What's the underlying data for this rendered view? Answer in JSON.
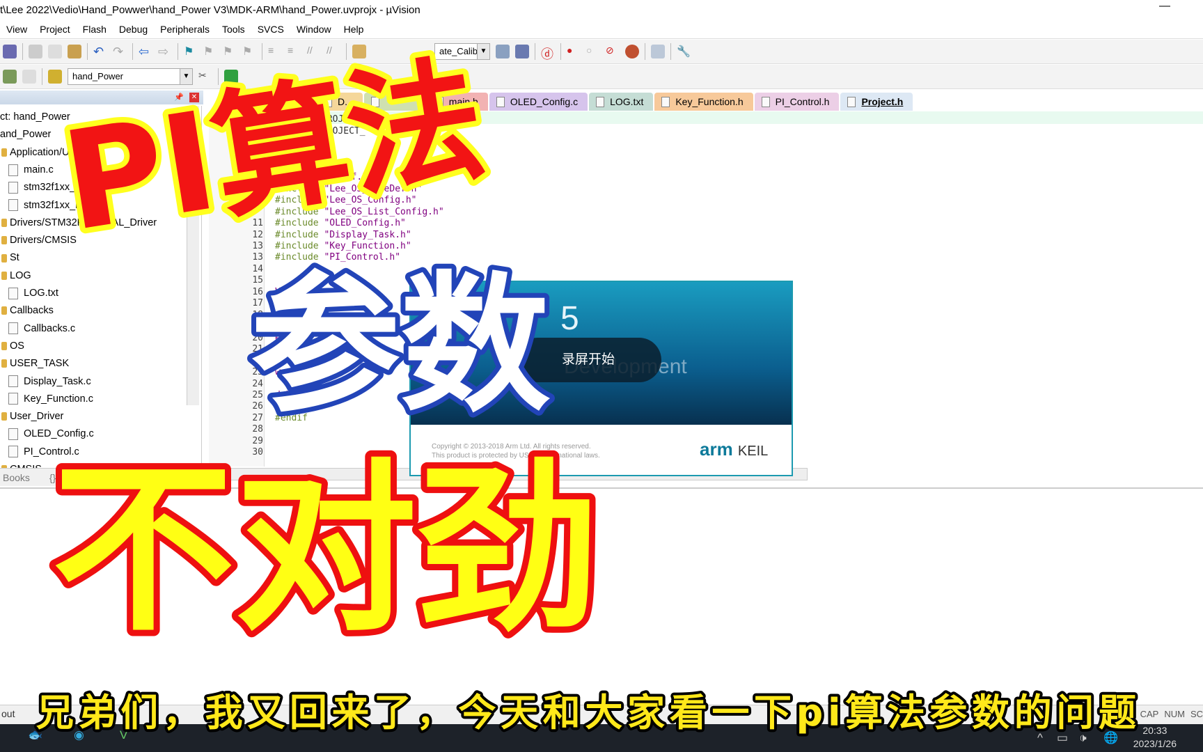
{
  "window": {
    "title": "t\\Lee 2022\\Vedio\\Hand_Powwer\\hand_Power V3\\MDK-ARM\\hand_Power.uvprojx - µVision",
    "minimize": "—"
  },
  "menu": [
    "View",
    "Project",
    "Flash",
    "Debug",
    "Peripherals",
    "Tools",
    "SVCS",
    "Window",
    "Help"
  ],
  "toolbar": {
    "config_combo": "ate_Calib",
    "target_combo": "hand_Power"
  },
  "project_panel": {
    "items": [
      {
        "label": "ct: hand_Power",
        "type": "root"
      },
      {
        "label": "and_Power",
        "type": "target"
      },
      {
        "label": "Application/U",
        "type": "group"
      },
      {
        "label": "main.c",
        "type": "file"
      },
      {
        "label": "stm32f1xx_",
        "type": "file"
      },
      {
        "label": "stm32f1xx_h",
        "type": "file"
      },
      {
        "label": "Drivers/STM32F1xx_HAL_Driver",
        "type": "group"
      },
      {
        "label": "Drivers/CMSIS",
        "type": "group"
      },
      {
        "label": "St",
        "type": "group"
      },
      {
        "label": "LOG",
        "type": "group"
      },
      {
        "label": "LOG.txt",
        "type": "file"
      },
      {
        "label": "Callbacks",
        "type": "group"
      },
      {
        "label": "Callbacks.c",
        "type": "file"
      },
      {
        "label": "OS",
        "type": "group"
      },
      {
        "label": "USER_TASK",
        "type": "group"
      },
      {
        "label": "Display_Task.c",
        "type": "file"
      },
      {
        "label": "Key_Function.c",
        "type": "file"
      },
      {
        "label": "User_Driver",
        "type": "group"
      },
      {
        "label": "OLED_Config.c",
        "type": "file"
      },
      {
        "label": "PI_Control.c",
        "type": "file"
      },
      {
        "label": "CMSIS",
        "type": "group"
      }
    ],
    "tabs": [
      "Books",
      "{} Functions"
    ]
  },
  "editor_tabs": [
    {
      "label": "D...",
      "color": "#f5d79a"
    },
    {
      "label": "",
      "color": "#cfe0b0"
    },
    {
      "label": "main.h",
      "color": "#f2b2b2"
    },
    {
      "label": "OLED_Config.c",
      "color": "#d6c4ec"
    },
    {
      "label": "LOG.txt",
      "color": "#c5ddd5"
    },
    {
      "label": "Key_Function.h",
      "color": "#f7c99a"
    },
    {
      "label": "PI_Control.h",
      "color": "#eccfe6"
    },
    {
      "label": "Project.h",
      "color": "#dde8f4",
      "active": true
    }
  ],
  "code": [
    {
      "n": "",
      "text": "PROJECT_"
    },
    {
      "n": "",
      "text": "PROJECT_"
    },
    {
      "n": "",
      "pp": "",
      "text": "\"Lee_OS_TypeDef.h\""
    },
    {
      "n": "",
      "pp": "#include ",
      "text": "\"Lee_OS_TypeDef.h\""
    },
    {
      "n": "",
      "pp": "#include ",
      "text": "\"Lee_OS_Config.h\""
    },
    {
      "n": "",
      "pp": "#include ",
      "text": "\"Lee_OS_List_Config.h\""
    },
    {
      "n": "11",
      "pp": "#include ",
      "text": "\"OLED_Config.h\""
    },
    {
      "n": "12",
      "pp": "#include ",
      "text": "\"Display_Task.h\""
    },
    {
      "n": "13",
      "pp": "#include ",
      "text": "\"Key_Function.h\""
    },
    {
      "n": "13",
      "pp": "#include ",
      "text": "\"PI_Control.h\""
    },
    {
      "n": "14",
      "text": ""
    },
    {
      "n": "15",
      "text": ""
    },
    {
      "n": "16",
      "text": "Va"
    },
    {
      "n": "17",
      "text": ""
    },
    {
      "n": "18",
      "text": ""
    },
    {
      "n": "19",
      "text": ""
    },
    {
      "n": "20",
      "text": "eD"
    },
    {
      "n": "21",
      "text": ""
    },
    {
      "n": "22",
      "text": ""
    },
    {
      "n": "23",
      "text": "we"
    },
    {
      "n": "24",
      "text": ""
    },
    {
      "n": "25",
      "text": "debug["
    },
    {
      "n": "26",
      "text": ""
    },
    {
      "n": "27",
      "pp": "#endif",
      "text": ""
    },
    {
      "n": "28",
      "text": ""
    },
    {
      "n": "29",
      "text": ""
    },
    {
      "n": "30",
      "text": ""
    }
  ],
  "splash": {
    "version": "5",
    "tagline": "Development",
    "recording": "录屏开始",
    "copyright": "Copyright © 2013-2018 Arm Ltd. All rights reserved.",
    "notice": "This product is protected by US and international laws.",
    "logo": "arm KEIL"
  },
  "status": {
    "output_tab": "out",
    "indicators": [
      "CAP",
      "NUM",
      "SC"
    ]
  },
  "taskbar": {
    "time": "20:33",
    "date": "2023/1/26"
  },
  "overlay": {
    "line1": "PI算法",
    "line2": "参数",
    "line3": "不对劲",
    "subtitle": "兄弟们，我又回来了，今天和大家看一下pi算法参数的问题"
  }
}
